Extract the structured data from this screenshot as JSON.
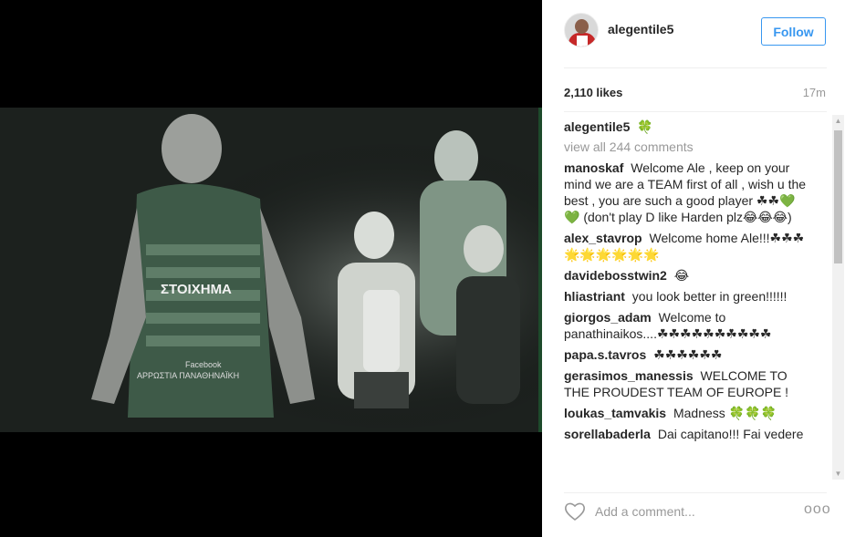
{
  "post": {
    "username": "alegentile5",
    "follow_label": "Follow",
    "likes": "2,110 likes",
    "time": "17m",
    "caption_user": "alegentile5",
    "caption_text": "🍀",
    "view_all": "view all 244 comments",
    "add_comment_placeholder": "Add a comment...",
    "more_label": "ooo"
  },
  "comments": [
    {
      "user": "manoskaf",
      "text": "Welcome Ale , keep on your mind we are a TEAM first of all , wish u the best , you are such a good player ☘☘💚💚 (don't play D like Harden plz😂😂😂)"
    },
    {
      "user": "alex_stavrop",
      "text": "Welcome home Ale!!!☘☘☘ 🌟🌟🌟🌟🌟🌟"
    },
    {
      "user": "davidebosstwin2",
      "text": "😂"
    },
    {
      "user": "hliastriant",
      "text": "you look better in green!!!!!!"
    },
    {
      "user": "giorgos_adam",
      "text": "Welcome to panathinaikos....☘☘☘☘☘☘☘☘☘☘"
    },
    {
      "user": "papa.s.tavros",
      "text": "☘☘☘☘☘☘"
    },
    {
      "user": "gerasimos_manessis",
      "text": "WELCOME TO THE PROUDEST TEAM OF EUROPE !"
    },
    {
      "user": "loukas_tamvakis",
      "text": "Madness 🍀🍀🍀"
    },
    {
      "user": "sorellabaderla",
      "text": "Dai capitano!!! Fai vedere"
    }
  ],
  "photo": {
    "jersey_text": "ΣΤΟΙΧΗΜΑ",
    "jersey_sub": "Facebook",
    "jersey_sub2": "ΑΡΡΩΣΤΙΑ ΠΑΝΑΘΗΝΑΪΚΗ"
  },
  "colors": {
    "accent": "#3897f0",
    "jersey_green": "#3e5a48"
  }
}
